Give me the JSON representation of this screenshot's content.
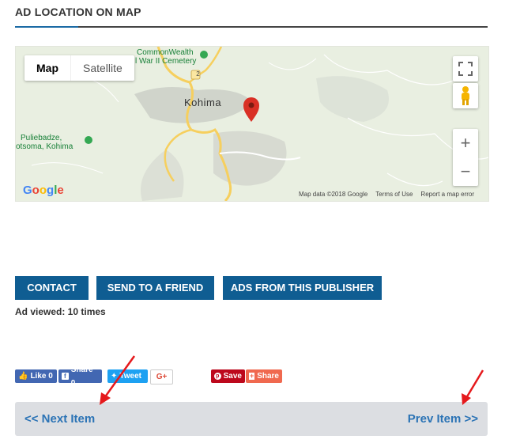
{
  "section": {
    "title": "AD LOCATION ON MAP"
  },
  "map": {
    "type_control": {
      "map_label": "Map",
      "satellite_label": "Satellite"
    },
    "labels": {
      "town": "Kohima",
      "poi_1_line1": "CommonWealth",
      "poi_1_line2": "l War II Cemetery",
      "poi_2_line1": "Puliebadze,",
      "poi_2_line2": "otsoma, Kohima",
      "road_number": "2"
    },
    "zoom_in_label": "+",
    "zoom_out_label": "−",
    "logo_text": "Google",
    "attribution": {
      "map_data": "Map data ©2018 Google",
      "terms": "Terms of Use",
      "report": "Report a map error"
    }
  },
  "actions": {
    "contact": "CONTACT",
    "send_friend": "SEND TO A FRIEND",
    "ads_publisher": "ADS FROM THIS PUBLISHER"
  },
  "stats": {
    "ad_viewed": "Ad viewed: 10 times"
  },
  "social": {
    "fb_like": "Like 0",
    "fb_share": "Share 0",
    "tweet": "Tweet",
    "gplus": "G+",
    "pin_save": "Save",
    "addthis_share": "Share"
  },
  "pager": {
    "next": "<< Next Item",
    "prev": "Prev Item >>"
  },
  "colors": {
    "accent": "#0f5d92",
    "link": "#2b73b5",
    "annotation_arrow": "#e5191c",
    "marker": "#d93025"
  }
}
